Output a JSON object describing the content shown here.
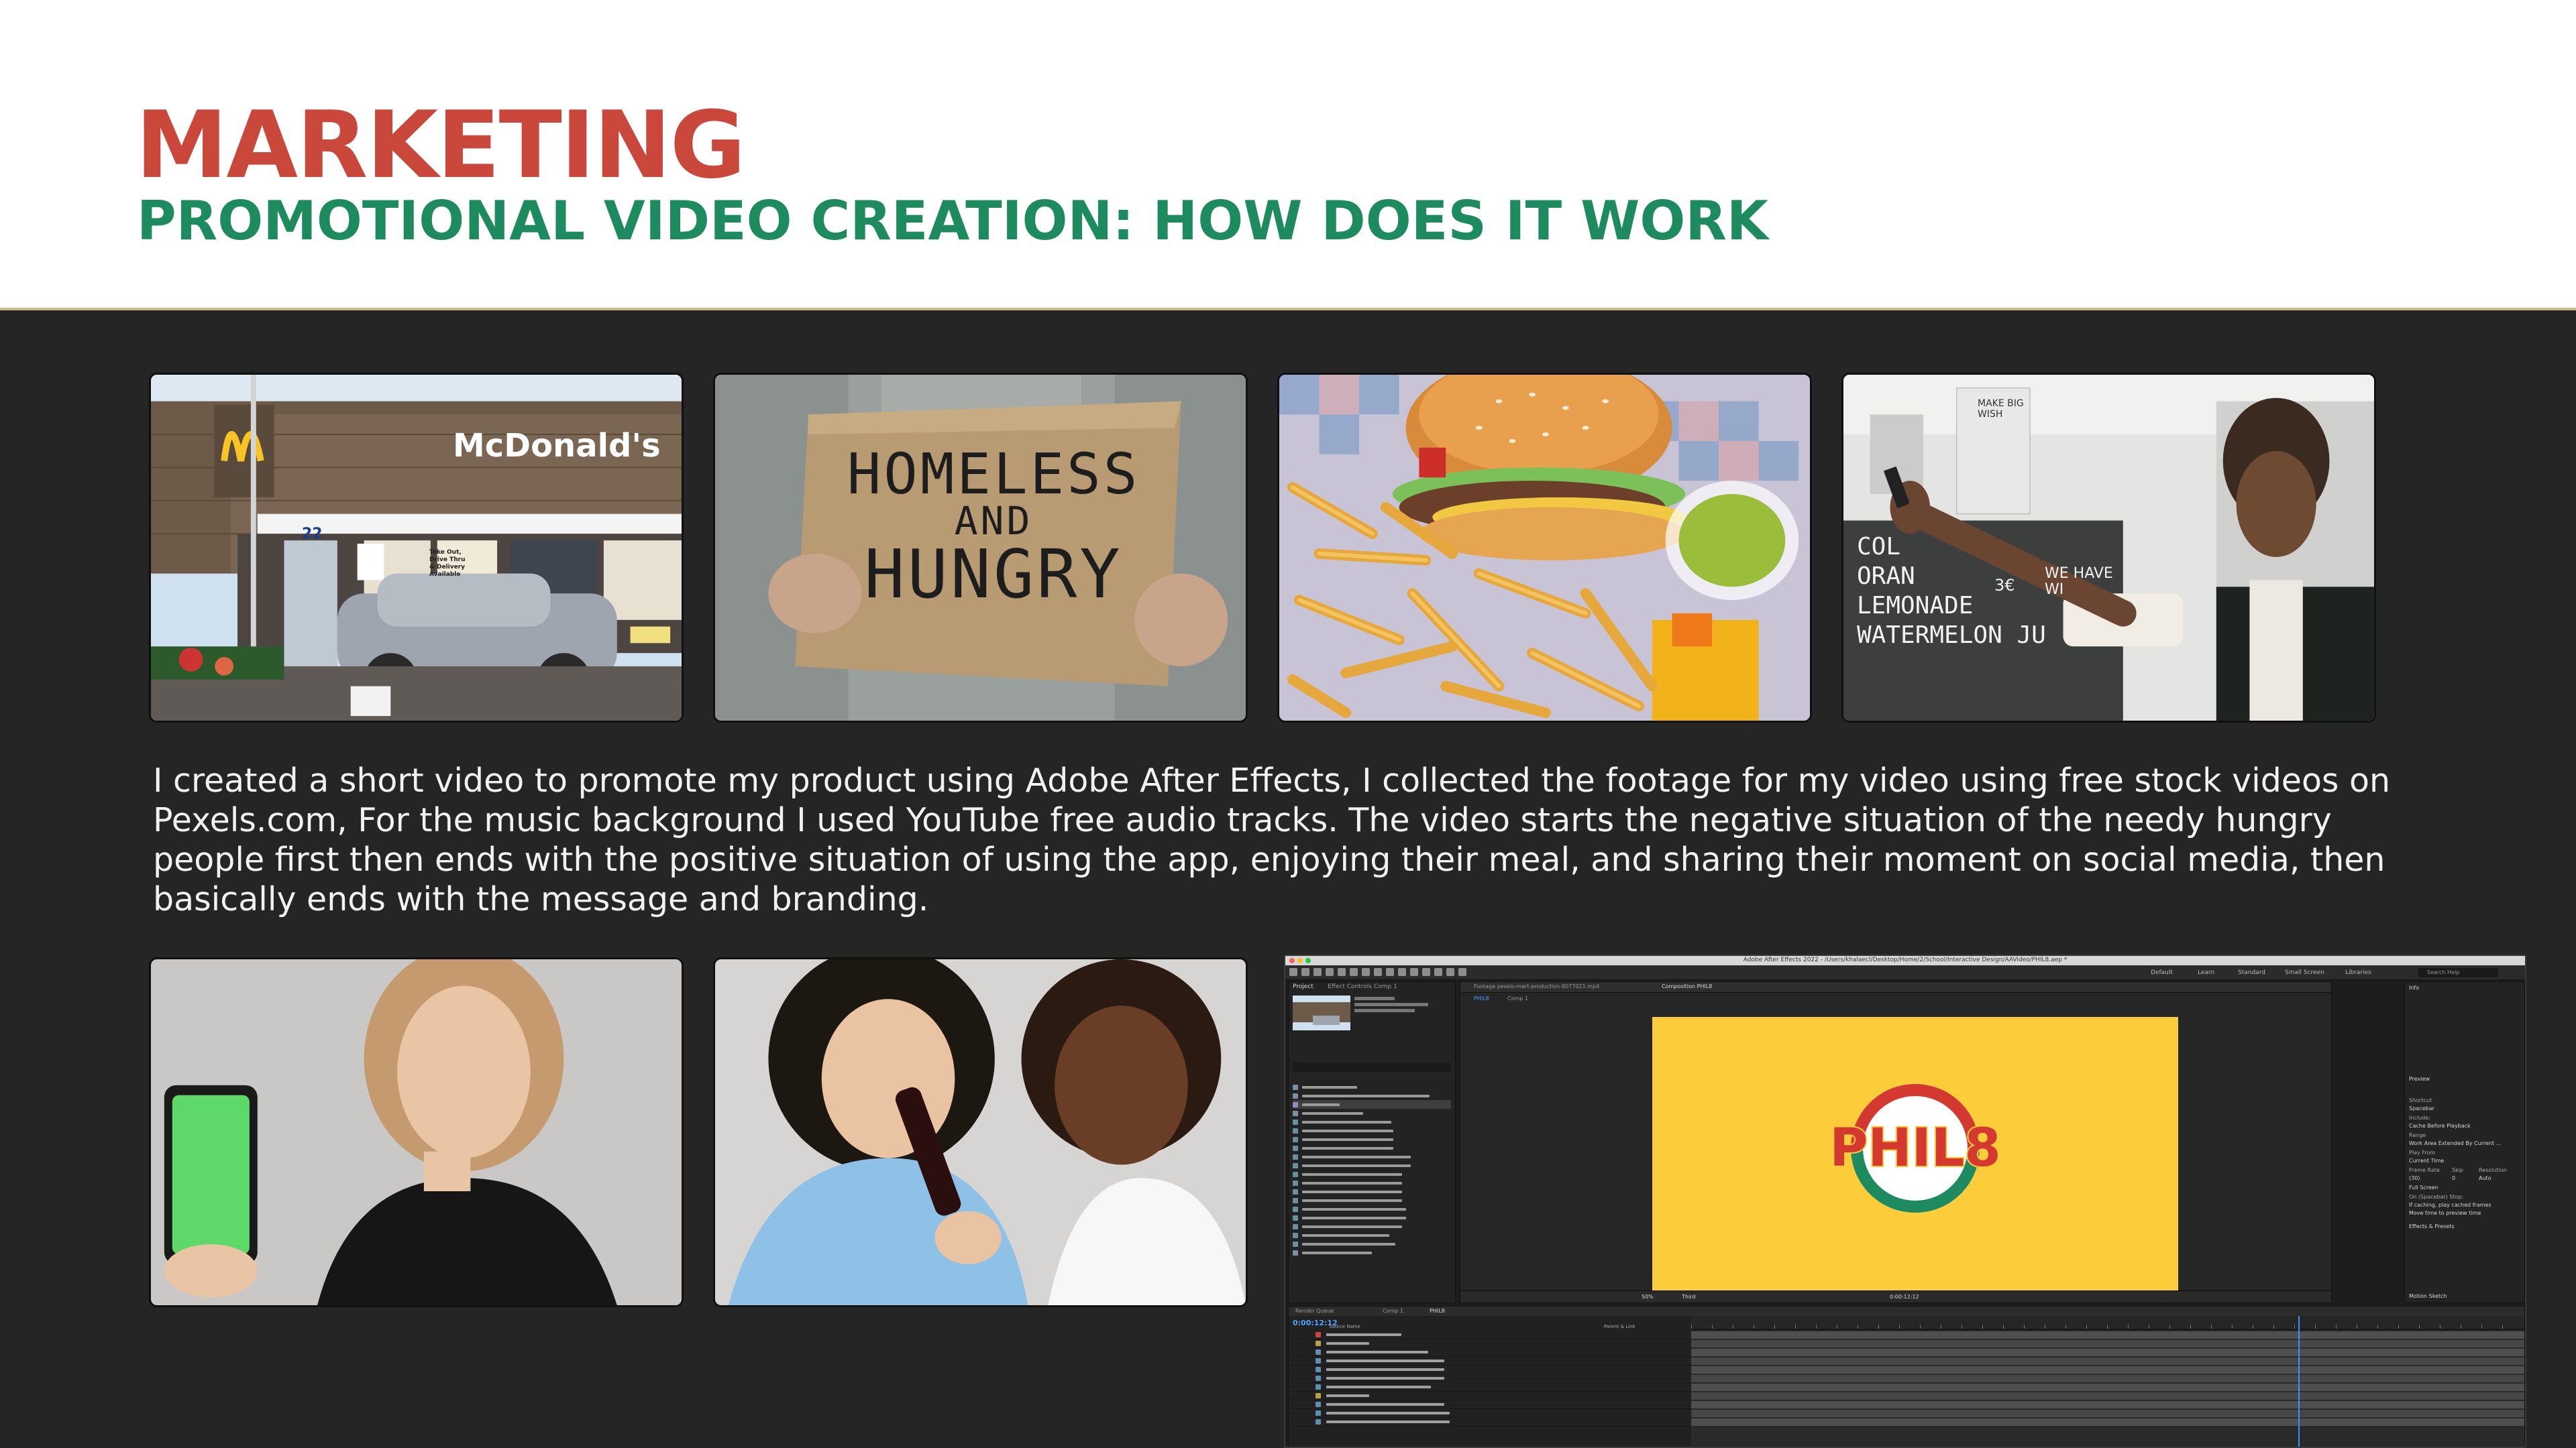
{
  "header": {
    "title": "MARKETING",
    "subtitle": "PROMOTIONAL VIDEO CREATION: HOW DOES IT WORK"
  },
  "colors": {
    "title": "#c9473b",
    "subtitle": "#1e8a5f",
    "background": "#252525",
    "header_bg": "#ffffff",
    "comp_yellow": "#fccc3a"
  },
  "photos": {
    "restaurant": {
      "sign_text": "McDonald's",
      "side_text": "Take Out, Drive Thru & Delivery Available",
      "stall_number": "22"
    },
    "homeless": {
      "sign_line1": "HOMELESS",
      "sign_line2": "AND",
      "sign_line3": "HUNGRY"
    },
    "burger": {},
    "selfie": {
      "chalkboard_lines": [
        "COL",
        "ORAN",
        "LEMONADE",
        "WATERMELON JU"
      ],
      "chalk_price": "3€",
      "chalk_corner": "MAKE BIG WISH",
      "chalk_note": "WE HAVE WI"
    },
    "phone_girl": {},
    "two_friends": {}
  },
  "description": "I created a short video to promote my product using Adobe After Effects, I collected the footage for my video using free stock videos on Pexels.com, For the music background I used YouTube free audio tracks. The video starts the negative situation of the needy hungry people first then ends with the positive situation of using the app, enjoying their meal, and sharing their moment on social media, then basically ends with the message and branding.",
  "after_effects": {
    "window_title": "Adobe After Effects 2022 - /Users/khalaecl/Desktop/Home/2/School/Interactive Design/AAVideo/PHIL8.aep *",
    "workspaces": [
      "Default",
      "Learn",
      "Standard",
      "Small Screen",
      "Libraries"
    ],
    "search_placeholder": "Search Help",
    "project_tab": "Project",
    "effect_controls_tab": "Effect Controls Comp 1",
    "comp_tab": "Composition PHIL8",
    "footage_tab": "Footage pexels-mart-production-8077021.mp4",
    "comp_subtabs": [
      "PHIL8",
      "Comp 1"
    ],
    "logo_text": "PHIL8",
    "zoom": "50%",
    "resolution": "Third",
    "timecode_small": "0:00:12:12",
    "right_panel": {
      "info": "Info",
      "preview": "Preview",
      "shortcut": "Shortcut",
      "spacebar": "Spacebar",
      "include": "Include:",
      "cache_before": "Cache Before Playback",
      "range": "Range",
      "range_value": "Work Area Extended By Current ...",
      "play_from": "Play From",
      "play_from_value": "Current Time",
      "frame_rate": "Frame Rate",
      "skip": "Skip",
      "resolution": "Resolution",
      "frame_rate_value": "(30)",
      "skip_value": "0",
      "resolution_value": "Auto",
      "full_screen": "Full Screen",
      "on_stop": "On (Spacebar) Stop:",
      "if_caching": "If caching, play cached frames",
      "move_time": "Move time to preview time",
      "effects": "Effects & Presets",
      "motion_sketch": "Motion Sketch"
    },
    "timeline": {
      "tabs": [
        "Render Queue",
        "Comp 1",
        "PHIL8"
      ],
      "current_time": "0:00:12:12",
      "layer_header": "Source Name",
      "parent_header": "Parent & Link",
      "layers": [
        "<empty text layer>",
        "Comp 4",
        "pexels-cityscape-2438766.mp4",
        "pexels-mart-production-8077091.mp4",
        "pexels-mart-production-8077011.mp4",
        "pexels-mart-production-8077021.mp4",
        "pexels-uriel-mont-6279118.mp4",
        "Comp 3",
        "pexels-julia-m-cameron-4899121.mp4",
        "pexels-kampus-production-2932446.mp4",
        "pexels-kampus-production-2932440.mp4"
      ],
      "parent_value": "None"
    },
    "project_files": [
      "bad phale.png",
      "FAIPng.com_apple-iron-png_2366610-0-Kol-X-5.png",
      "PHIL8",
      "PHIL8(2)-10x.png",
      "pexels-uriel-mont-6279118.mp4",
      "pexels-timur-weber-9513576.mp4",
      "pexels-timur-weber-9513577.mp4",
      "pexels-severo-lona-1983776.mp4",
      "pexels-polina-tankilevitch-4200029.mp4",
      "pexels-polina-tankilevitch-4200029.mp4",
      "pexels-mart-production-9338025.mp4",
      "pexels-mart-production-8077091.mp4",
      "pexels-mart-production-8077011.mp4",
      "pexels-mart-production-8077021.mp4",
      "pexels-kampus-production-5932447.mp4",
      "pexels-kampus-production-2932440.mp4",
      "pexels-julia-m-cameron-4899121.mp4",
      "pexels-cityscape-2438766.mp4",
      "pexels-bruno-studio-2988016.mp4",
      "iPhone 6_30 - 10.png"
    ]
  }
}
